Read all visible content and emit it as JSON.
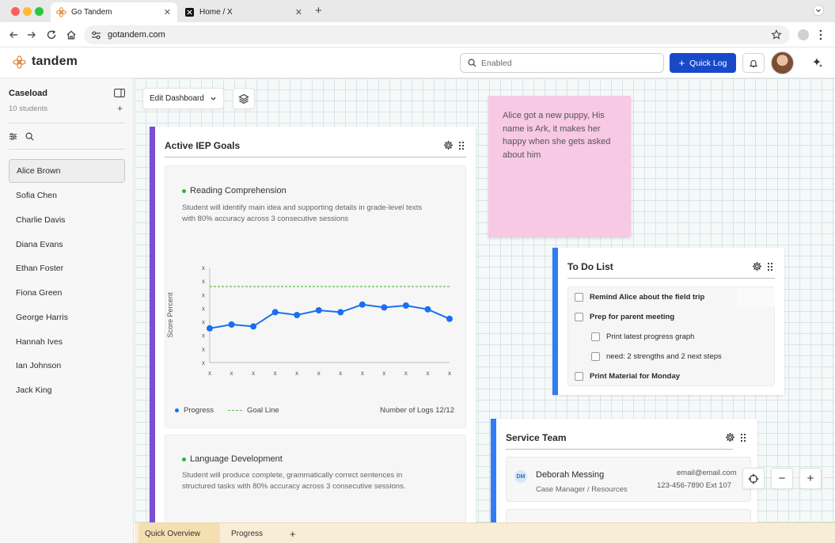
{
  "browser": {
    "tabs": [
      {
        "label": "Go Tandem",
        "active": true
      },
      {
        "label": "Home / X",
        "active": false
      }
    ],
    "url": "gotandem.com"
  },
  "header": {
    "logo_text": "tandem",
    "search_placeholder": "Enabled",
    "quick_log_label": "Quick Log"
  },
  "sidebar": {
    "title": "Caseload",
    "count": "10 students",
    "students": [
      {
        "name": "Alice Brown",
        "selected": true
      },
      {
        "name": "Sofia Chen"
      },
      {
        "name": "Charlie Davis"
      },
      {
        "name": "Diana Evans"
      },
      {
        "name": "Ethan Foster"
      },
      {
        "name": "Fiona Green"
      },
      {
        "name": "George Harris"
      },
      {
        "name": "Hannah Ives"
      },
      {
        "name": "Ian Johnson"
      },
      {
        "name": "Jack King"
      }
    ]
  },
  "toolbar": {
    "edit_dashboard": "Edit Dashboard"
  },
  "iep": {
    "title": "Active IEP Goals",
    "goals": [
      {
        "name": "Reading Comprehension",
        "desc_line1": "Student will identify main idea and supporting details in grade-level texts",
        "desc_line2": "with 80% accuracy across 3 consecutive sessions"
      },
      {
        "name": "Language Development",
        "desc_line1": "Student will produce complete, grammatically correct sentences in",
        "desc_line2": "structured tasks with 80% accuracy across 3 consecutive sessions."
      }
    ],
    "legend_progress": "Progress",
    "legend_goal": "Goal Line",
    "logs_count": "Number of Logs 12/12"
  },
  "chart_data": {
    "type": "line",
    "ylabel": "Score Percent",
    "x_tick_labels": [
      "x",
      "x",
      "x",
      "x",
      "x",
      "x",
      "x",
      "x",
      "x",
      "x",
      "x",
      "x"
    ],
    "y_tick_labels": [
      "x",
      "x",
      "x",
      "x",
      "x",
      "x",
      "x",
      "x"
    ],
    "ylim": [
      0,
      100
    ],
    "goal_line": 80,
    "legend_position": "bottom-left",
    "series": [
      {
        "name": "Progress",
        "color": "#1a6ff0",
        "values": [
          36,
          40,
          38,
          53,
          50,
          55,
          53,
          61,
          58,
          60,
          56,
          46
        ]
      }
    ],
    "goal_color": "#5cbf4a"
  },
  "sticky_note": {
    "text": "Alice got a new puppy, His name is Ark, it makes her happy when she gets asked about him"
  },
  "todo": {
    "title": "To Do List",
    "items": [
      {
        "text": "Remind Alice about the field trip",
        "bold": true,
        "indent": false
      },
      {
        "text": "Prep for parent meeting",
        "bold": true,
        "indent": false
      },
      {
        "text": "Print latest progress graph",
        "bold": false,
        "indent": true
      },
      {
        "text": "need: 2 strengths and 2 next steps",
        "bold": false,
        "indent": true
      },
      {
        "text": "Print Material for Monday",
        "bold": true,
        "indent": false
      }
    ]
  },
  "service_team": {
    "title": "Service Team",
    "members": [
      {
        "initials": "DM",
        "name": "Deborah Messing",
        "role": "Case Manager / Resources",
        "email": "email@email.com",
        "phone": "123-456-7890 Ext 107"
      }
    ]
  },
  "bottom_tabs": [
    {
      "label": "Quick Overview",
      "active": true
    },
    {
      "label": "Progress",
      "active": false
    }
  ],
  "colors": {
    "primary": "#1849c9",
    "iep_accent": "#7c4fd1",
    "todo_accent": "#2f7cf6",
    "sticky": "#f7c9e4"
  }
}
